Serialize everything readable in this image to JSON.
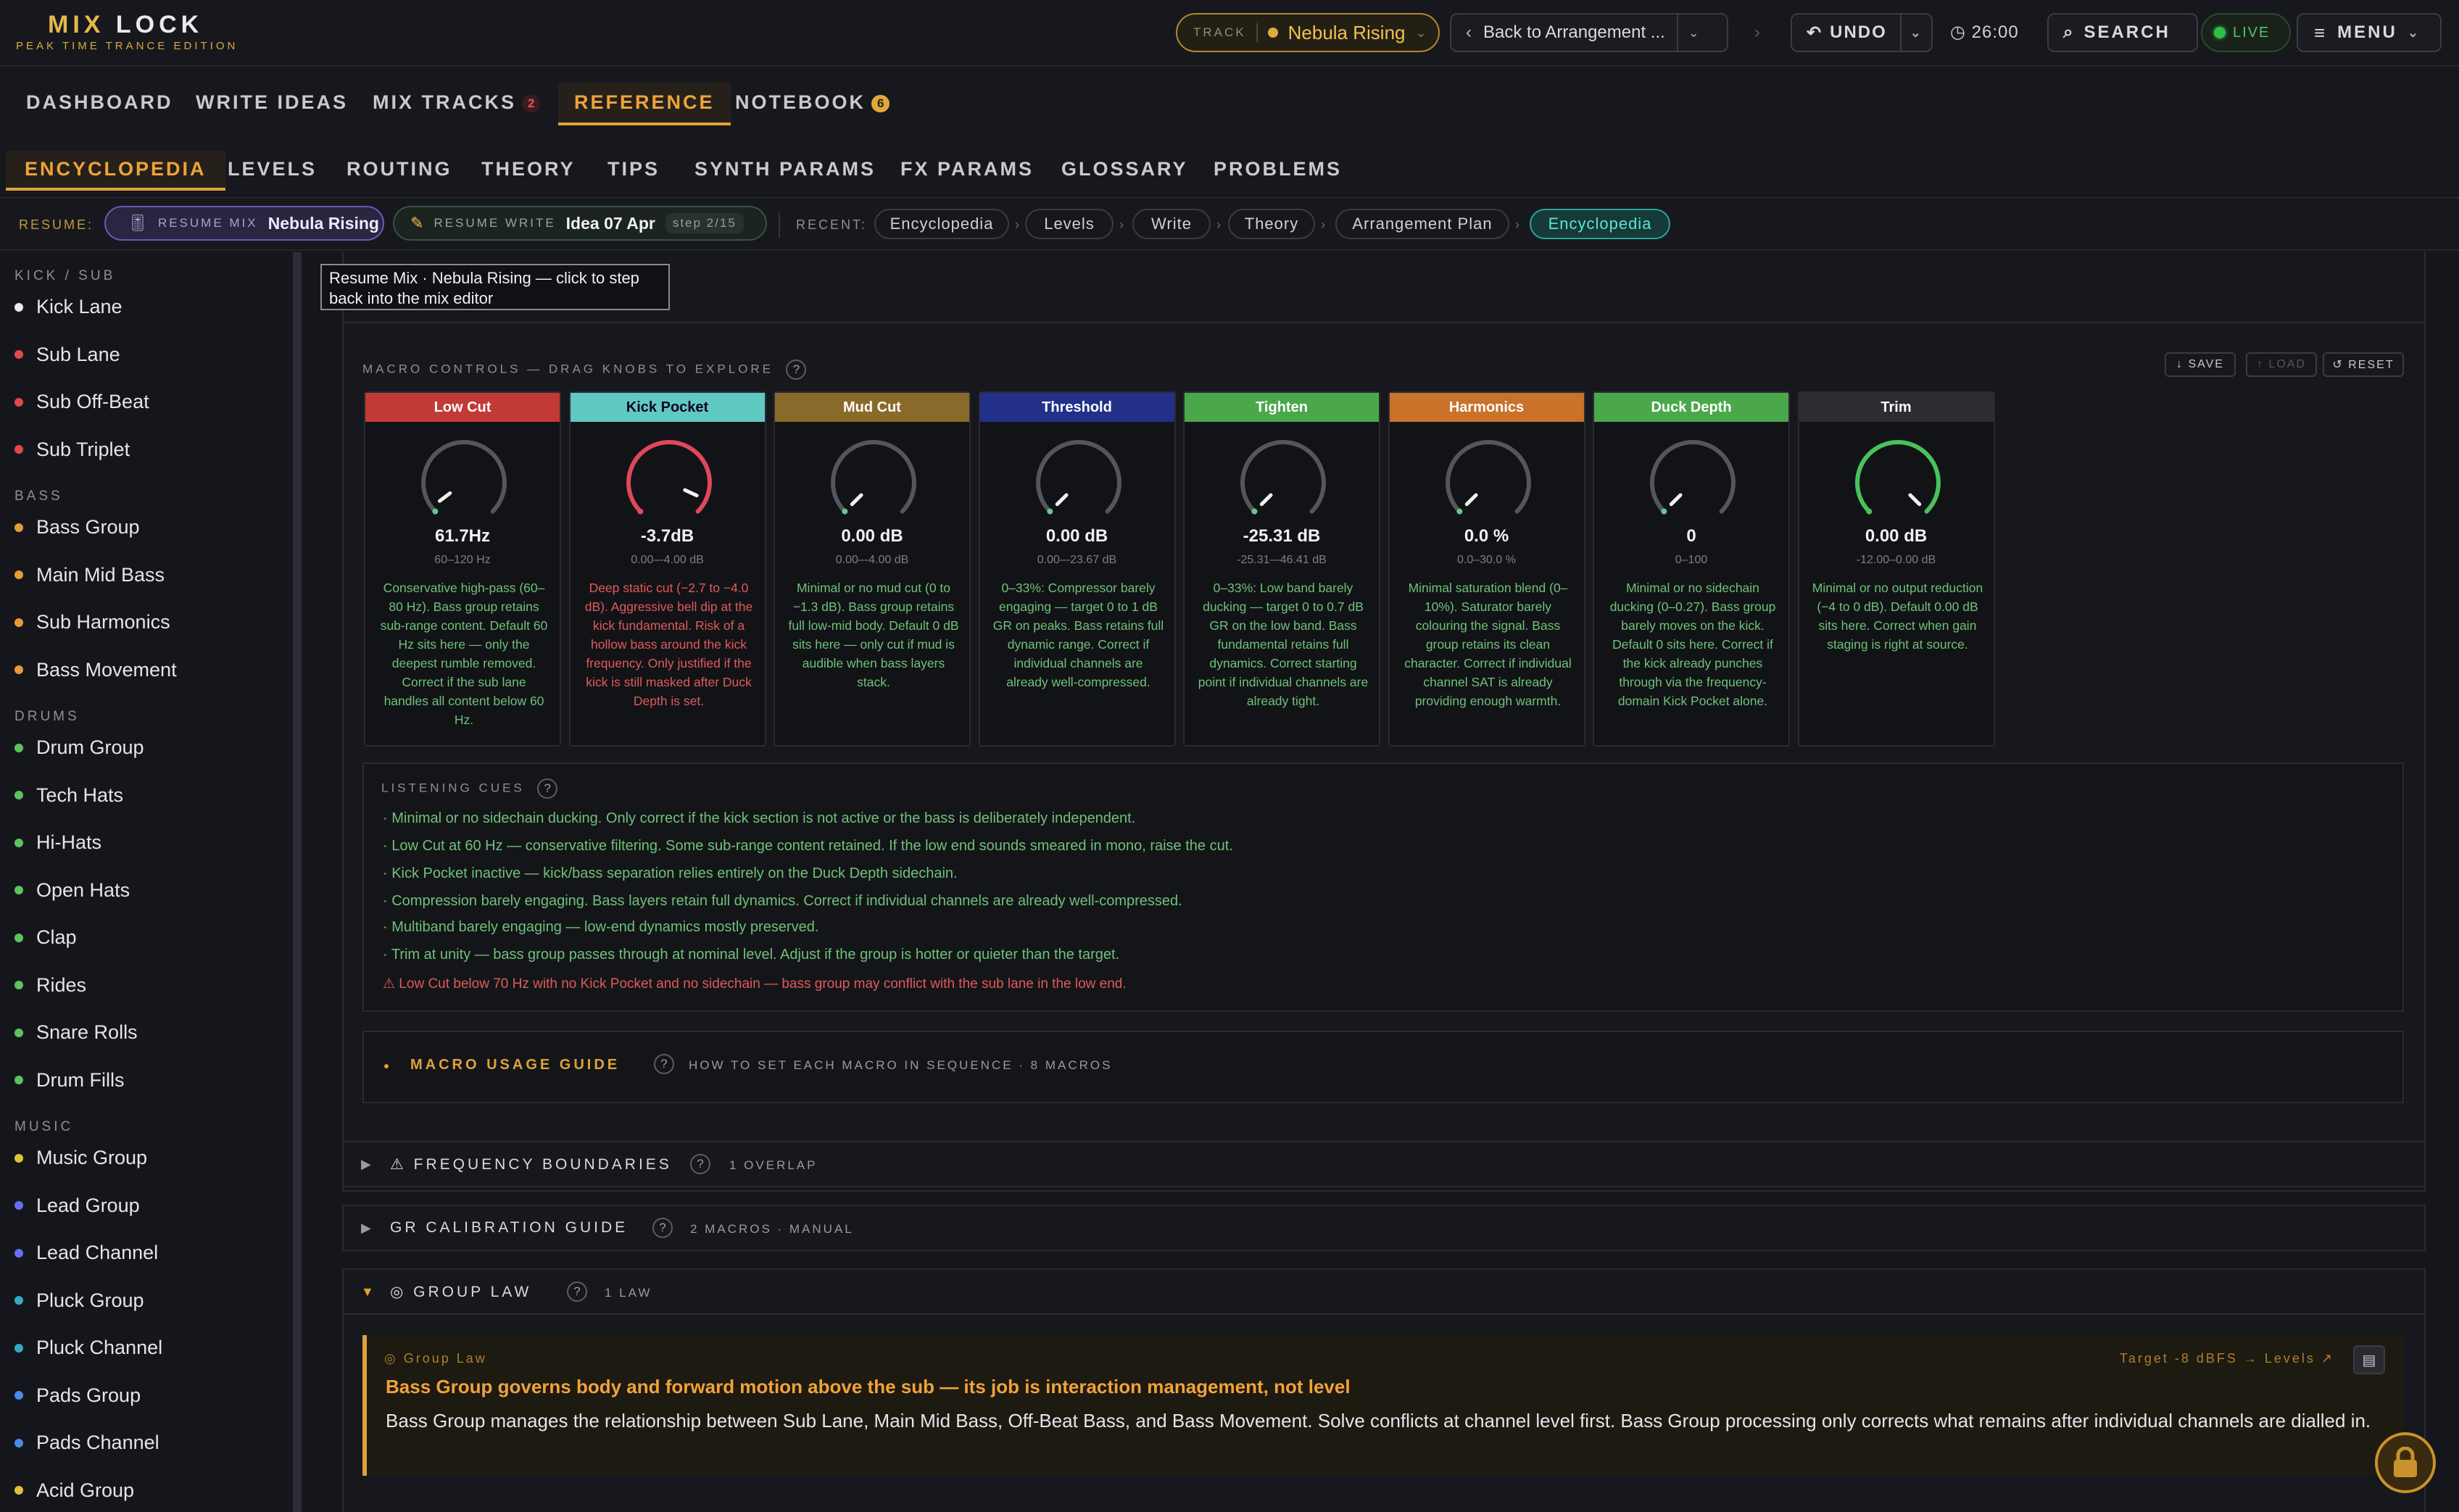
{
  "app": {
    "title_a": "MIX",
    "title_b": "LOCK",
    "subtitle": "PEAK TIME TRANCE EDITION"
  },
  "topbar": {
    "track_label": "TRACK",
    "track_name": "Nebula Rising",
    "back_label": "Back to Arrangement ...",
    "undo_label": "UNDO",
    "time": "26:00",
    "search_label": "SEARCH",
    "live_label": "LIVE",
    "menu_label": "MENU"
  },
  "nav_main": [
    {
      "label": "DASHBOARD"
    },
    {
      "label": "WRITE IDEAS"
    },
    {
      "label": "MIX TRACKS",
      "badge": "2"
    },
    {
      "label": "REFERENCE"
    },
    {
      "label": "NOTEBOOK",
      "badge": "6"
    }
  ],
  "nav_sub": [
    "ENCYCLOPEDIA",
    "LEVELS",
    "ROUTING",
    "THEORY",
    "TIPS",
    "SYNTH PARAMS",
    "FX PARAMS",
    "GLOSSARY",
    "PROBLEMS"
  ],
  "resume": {
    "label": "RESUME:",
    "mix_key": "RESUME MIX",
    "mix_value": "Nebula Rising",
    "write_key": "RESUME WRITE",
    "write_value": "Idea 07 Apr",
    "write_step": "step 2/15",
    "recent_label": "RECENT:",
    "recent": [
      "Encyclopedia",
      "Levels",
      "Write",
      "Theory",
      "Arrangement Plan",
      "Encyclopedia"
    ]
  },
  "tooltip": "Resume Mix · Nebula Rising — click to step back into the mix editor",
  "sidebar": {
    "groups": [
      {
        "title": "KICK / SUB",
        "items": [
          {
            "label": "Kick Lane",
            "color": "#e9e9ee"
          },
          {
            "label": "Sub Lane",
            "color": "#e0484e"
          },
          {
            "label": "Sub Off-Beat",
            "color": "#e0484e"
          },
          {
            "label": "Sub Triplet",
            "color": "#e0484e"
          }
        ]
      },
      {
        "title": "BASS",
        "items": [
          {
            "label": "Bass Group",
            "color": "#e79a3a"
          },
          {
            "label": "Main Mid Bass",
            "color": "#e79a3a"
          },
          {
            "label": "Sub Harmonics",
            "color": "#e79a3a"
          },
          {
            "label": "Bass Movement",
            "color": "#e79a3a"
          }
        ]
      },
      {
        "title": "DRUMS",
        "items": [
          {
            "label": "Drum Group",
            "color": "#5cc45a"
          },
          {
            "label": "Tech Hats",
            "color": "#5cc45a"
          },
          {
            "label": "Hi-Hats",
            "color": "#5cc45a"
          },
          {
            "label": "Open Hats",
            "color": "#5cc45a"
          },
          {
            "label": "Clap",
            "color": "#5cc45a"
          },
          {
            "label": "Rides",
            "color": "#5cc45a"
          },
          {
            "label": "Snare Rolls",
            "color": "#5cc45a"
          },
          {
            "label": "Drum Fills",
            "color": "#5cc45a"
          }
        ]
      },
      {
        "title": "MUSIC",
        "items": [
          {
            "label": "Music Group",
            "color": "#e0c23a"
          },
          {
            "label": "Lead Group",
            "color": "#6a6ef0"
          },
          {
            "label": "Lead Channel",
            "color": "#6a6ef0"
          },
          {
            "label": "Pluck Group",
            "color": "#3aa8c4"
          },
          {
            "label": "Pluck Channel",
            "color": "#3aa8c4"
          },
          {
            "label": "Pads Group",
            "color": "#4a8ae8"
          },
          {
            "label": "Pads Channel",
            "color": "#4a8ae8"
          },
          {
            "label": "Acid Group",
            "color": "#e0c23a"
          }
        ]
      }
    ]
  },
  "macro": {
    "heading": "MACRO CONTROLS — DRAG KNOBS TO EXPLORE",
    "save": "↓ SAVE",
    "load": "↑ LOAD",
    "reset": "↺ RESET",
    "knobs": [
      {
        "name": "Low Cut",
        "header_color": "#c23a36",
        "value": "61.7Hz",
        "range": "60–120 Hz",
        "level": 0.03,
        "ring": "#55565d",
        "desc_color": "#6fc178",
        "desc": "Conservative high-pass (60–80 Hz). Bass group retains sub-range content. Default 60 Hz sits here — only the deepest rumble removed. Correct if the sub lane handles all content below 60 Hz."
      },
      {
        "name": "Kick Pocket",
        "header_color": "#5fc9c2",
        "value": "-3.7dB",
        "range": "0.00–-4.00 dB",
        "level": 0.925,
        "ring": "#e0485a",
        "desc_color": "#e05a5a",
        "desc": "Deep static cut (−2.7 to −4.0 dB). Aggressive bell dip at the kick fundamental. Risk of a hollow bass around the kick frequency. Only justified if the kick is still masked after Duck Depth is set."
      },
      {
        "name": "Mud Cut",
        "header_color": "#8a6a2a",
        "value": "0.00 dB",
        "range": "0.00–-4.00 dB",
        "level": 0.0,
        "ring": "#55565d",
        "desc_color": "#6fc178",
        "desc": "Minimal or no mud cut (0 to −1.3 dB). Bass group retains full low-mid body. Default 0 dB sits here — only cut if mud is audible when bass layers stack."
      },
      {
        "name": "Threshold",
        "header_color": "#22308a",
        "value": "0.00 dB",
        "range": "0.00–-23.67 dB",
        "level": 0.0,
        "ring": "#55565d",
        "desc_color": "#6fc178",
        "desc": "0–33%: Compressor barely engaging — target 0 to 1 dB GR on peaks. Bass retains full dynamic range. Correct if individual channels are already well-compressed."
      },
      {
        "name": "Tighten",
        "header_color": "#4aa84a",
        "value": "-25.31 dB",
        "range": "-25.31–-46.41 dB",
        "level": 0.0,
        "ring": "#55565d",
        "desc_color": "#6fc178",
        "desc": "0–33%: Low band barely ducking — target 0 to 0.7 dB GR on the low band. Bass fundamental retains full dynamics. Correct starting point if individual channels are already tight."
      },
      {
        "name": "Harmonics",
        "header_color": "#c9722a",
        "value": "0.0 %",
        "range": "0.0–30.0 %",
        "level": 0.0,
        "ring": "#55565d",
        "desc_color": "#6fc178",
        "desc": "Minimal saturation blend (0–10%). Saturator barely colouring the signal. Bass group retains its clean character. Correct if individual channel SAT is already providing enough warmth."
      },
      {
        "name": "Duck Depth",
        "header_color": "#4aa84a",
        "value": "0",
        "range": "0–100",
        "level": 0.0,
        "ring": "#55565d",
        "desc_color": "#6fc178",
        "desc": "Minimal or no sidechain ducking (0–0.27). Bass group barely moves on the kick. Default 0 sits here. Correct if the kick already punches through via the frequency-domain Kick Pocket alone."
      },
      {
        "name": "Trim",
        "header_color": "#2c2d33",
        "value": "0.00 dB",
        "range": "-12.00–0.00 dB",
        "level": 1.0,
        "ring": "#4ac25a",
        "desc_color": "#6fc178",
        "desc": "Minimal or no output reduction (−4 to 0 dB). Default 0.00 dB sits here. Correct when gain staging is right at source."
      }
    ]
  },
  "cues": {
    "heading": "LISTENING CUES",
    "items": [
      "· Minimal or no sidechain ducking. Only correct if the kick section is not active or the bass is deliberately independent.",
      "· Low Cut at 60 Hz — conservative filtering. Some sub-range content retained. If the low end sounds smeared in mono, raise the cut.",
      "· Kick Pocket inactive — kick/bass separation relies entirely on the Duck Depth sidechain.",
      "· Compression barely engaging. Bass layers retain full dynamics. Correct if individual channels are already well-compressed.",
      "· Multiband barely engaging — low-end dynamics mostly preserved.",
      "· Trim at unity — bass group passes through at nominal level. Adjust if the group is hotter or quieter than the target."
    ],
    "warning": "⚠ Low Cut below 70 Hz with no Kick Pocket and no sidechain — bass group may conflict with the sub lane in the low end."
  },
  "guide": {
    "title": "MACRO USAGE GUIDE",
    "sub": "HOW TO SET EACH MACRO IN SEQUENCE · 8 MACROS"
  },
  "sections": [
    {
      "title": "⚠ FREQUENCY BOUNDARIES",
      "sub": "1 OVERLAP",
      "open": false
    },
    {
      "title": "GR CALIBRATION GUIDE",
      "sub": "2 MACROS · MANUAL",
      "open": false
    },
    {
      "title": "◎ GROUP LAW",
      "sub": "1 LAW",
      "open": true
    }
  ],
  "law": {
    "kicker": "◎ Group Law",
    "title": "Bass Group governs body and forward motion above the sub — its job is interaction management, not level",
    "body": "Bass Group manages the relationship between Sub Lane, Main Mid Bass, Off-Beat Bass, and Bass Movement. Solve conflicts at channel level first. Bass Group processing only corrects what remains after individual channels are dialled in.",
    "target": "Target -8 dBFS → Levels ↗"
  }
}
